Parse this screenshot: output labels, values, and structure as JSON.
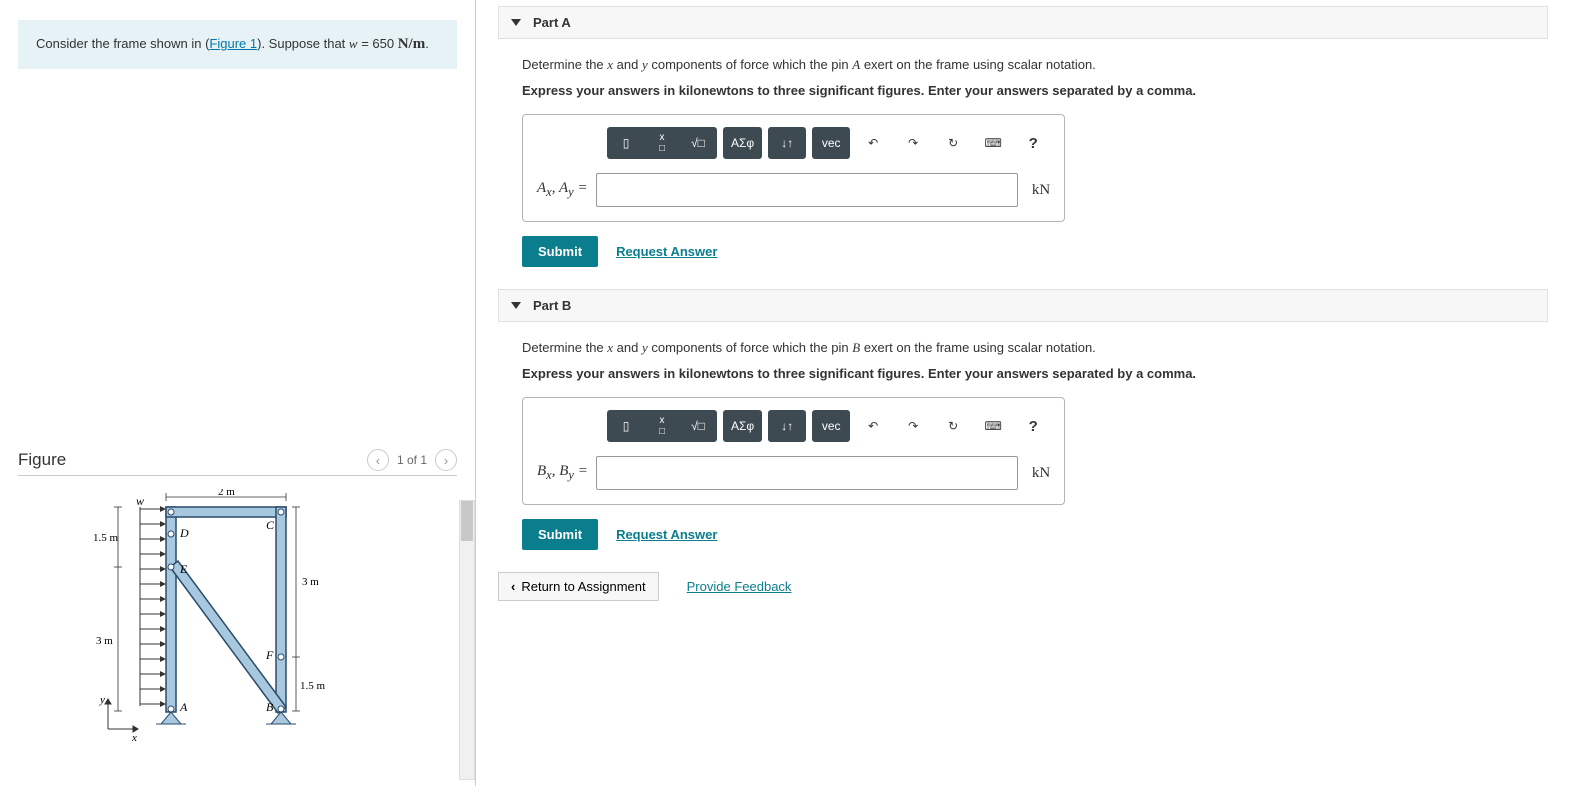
{
  "problem": {
    "prompt_prefix": "Consider the frame shown in (",
    "figure_link": "Figure 1",
    "prompt_suffix": "). Suppose that ",
    "var_name": "w",
    "var_eq": " = 650 ",
    "var_unit": "N/m",
    "prompt_end": "."
  },
  "figure": {
    "title": "Figure",
    "pager": "1 of 1",
    "labels": {
      "w": "w",
      "d": "D",
      "c": "C",
      "e": "E",
      "f": "F",
      "a": "A",
      "b": "B",
      "y": "y",
      "x": "x",
      "dim_2m": "2 m",
      "dim_15m_top": "1.5 m",
      "dim_3m_right": "3 m",
      "dim_3m_left": "3 m",
      "dim_15m_bot": "1.5 m"
    }
  },
  "parts": {
    "a": {
      "title": "Part A",
      "instr_pre": "Determine the ",
      "instr_x": "x",
      "instr_mid": " and ",
      "instr_y": "y",
      "instr_mid2": " components of force which the pin ",
      "pin": "A",
      "instr_post": " exert on the frame using scalar notation.",
      "instr2": "Express your answers in kilonewtons to three significant figures. Enter your answers separated by a comma.",
      "var_label_html": "A_x, A_y =",
      "unit": "kN",
      "submit": "Submit",
      "request": "Request Answer"
    },
    "b": {
      "title": "Part B",
      "instr_pre": "Determine the ",
      "instr_x": "x",
      "instr_mid": " and ",
      "instr_y": "y",
      "instr_mid2": " components of force which the pin ",
      "pin": "B",
      "instr_post": " exert on the frame using scalar notation.",
      "instr2": "Express your answers in kilonewtons to three significant figures. Enter your answers separated by a comma.",
      "var_label_html": "B_x, B_y =",
      "unit": "kN",
      "submit": "Submit",
      "request": "Request Answer"
    }
  },
  "toolbar": {
    "template": "▯",
    "frac": "x/□",
    "sqrt": "√□",
    "greek": "ΑΣφ",
    "subsup": "↓↑",
    "vec": "vec",
    "undo": "↶",
    "redo": "↷",
    "reset": "↻",
    "keyboard": "⌨",
    "help": "?"
  },
  "footer": {
    "return": "Return to Assignment",
    "feedback": "Provide Feedback"
  }
}
